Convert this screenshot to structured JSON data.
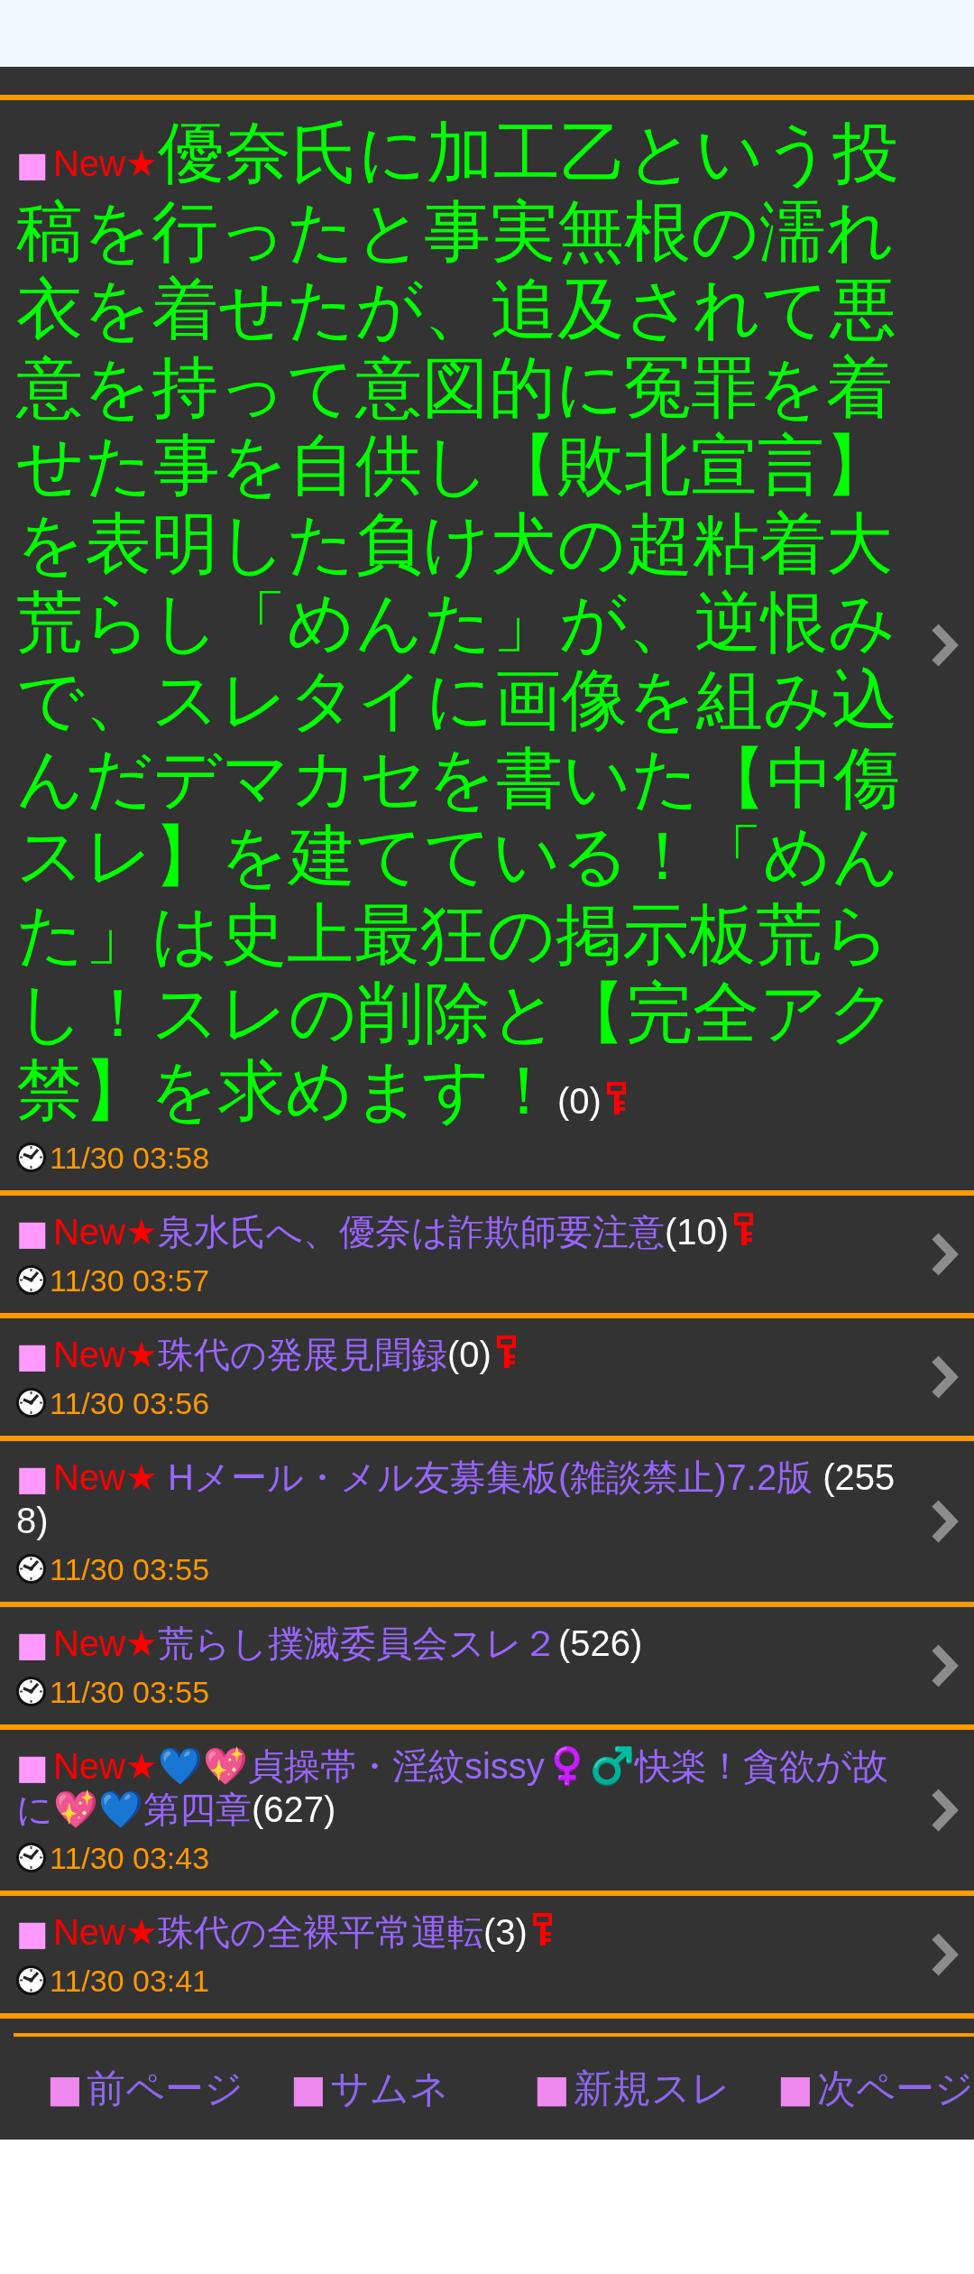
{
  "threads": [
    {
      "kind": "highlight",
      "marker": "■",
      "label": "New★",
      "title": "優奈氏に加工乙という投稿を行ったと事実無根の濡れ衣を着せたが、追及されて悪意を持って意図的に冤罪を着せた事を自供し【敗北宣言】を表明した負け犬の超粘着大荒らし「めんた」が、逆恨みで、スレタイに画像を組み込んだデマカセを書いた【中傷スレ】を建てている！「めんた」は史上最狂の掲示板荒らし！スレの削除と【完全アク禁】を求めます！",
      "count": "(0)",
      "key": true,
      "time": "11/30 03:58"
    },
    {
      "kind": "normal",
      "marker": "■",
      "label": "New★",
      "title": "泉水氏へ、優奈は詐欺師要注意",
      "count": "(10)",
      "key": true,
      "time": "11/30 03:57"
    },
    {
      "kind": "normal",
      "marker": "■",
      "label": "New★",
      "title": "珠代の発展見聞録",
      "count": "(0)",
      "key": true,
      "time": "11/30 03:56"
    },
    {
      "kind": "normal",
      "marker": "■",
      "label": "New★",
      "title": " Hメール・メル友募集板(雑談禁止)7.2版 ",
      "count": "(2558)",
      "key": false,
      "time": "11/30 03:55"
    },
    {
      "kind": "normal",
      "marker": "■",
      "label": "New★",
      "title": "荒らし撲滅委員会スレ２",
      "count": "(526)",
      "key": false,
      "time": "11/30 03:55"
    },
    {
      "kind": "normal",
      "marker": "■",
      "label": "New★",
      "title": "💙💖貞操帯・淫紋sissy♀️♂️快楽！貪欲が故に💖💙第四章",
      "count": "(627)",
      "key": false,
      "time": "11/30 03:43"
    },
    {
      "kind": "normal",
      "marker": "■",
      "label": "New★",
      "title": "珠代の全裸平常運転",
      "count": "(3)",
      "key": true,
      "time": "11/30 03:41"
    }
  ],
  "page_nav": [
    {
      "marker": "■",
      "label": "前ページ"
    },
    {
      "marker": "■",
      "label": "サムネ"
    },
    {
      "marker": "■",
      "label": "新規スレ"
    },
    {
      "marker": "■",
      "label": "次ページ"
    }
  ]
}
